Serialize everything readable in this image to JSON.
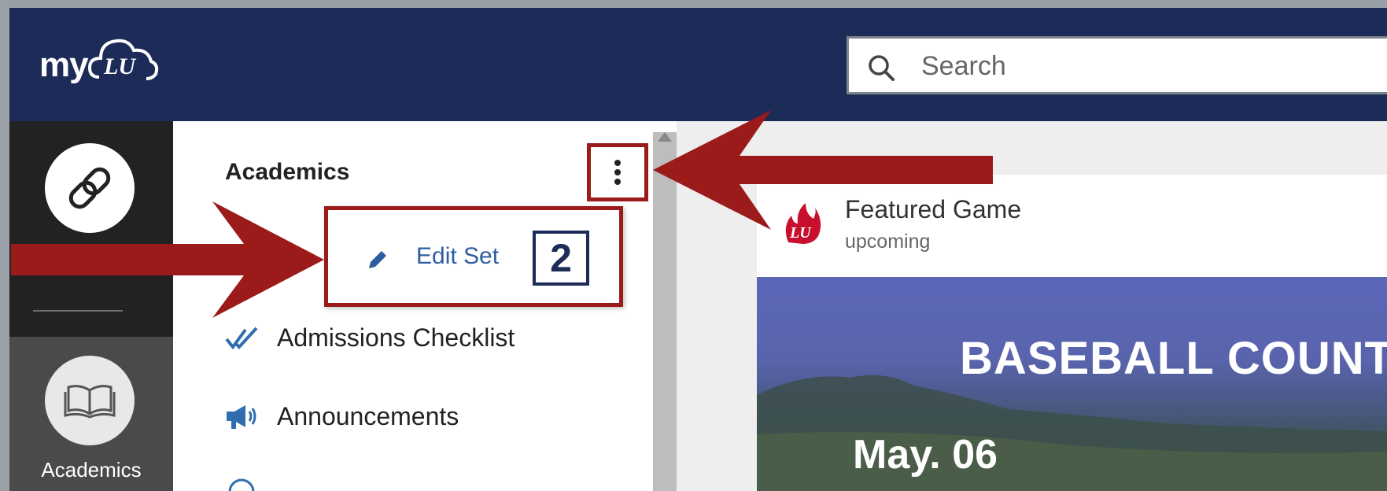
{
  "app": {
    "logo_text": "my"
  },
  "search": {
    "placeholder": "Search",
    "value": ""
  },
  "rail": {
    "active_label": "Academics"
  },
  "panel": {
    "title": "Academics",
    "menu": {
      "edit_label": "Edit Set"
    },
    "items": [
      {
        "label": "Admissions Checklist",
        "icon": "double-check-icon"
      },
      {
        "label": "Announcements",
        "icon": "megaphone-icon"
      }
    ]
  },
  "card": {
    "title": "Featured Game",
    "subtitle": "upcoming",
    "banner_title": "BASEBALL COUNTD",
    "banner_date": "May. 06"
  },
  "annotations": {
    "step_number": "2",
    "arrow_color": "#9b1a1a",
    "badge_color": "#1c2b57"
  },
  "colors": {
    "topbar": "#1c2b57",
    "rail_dark": "#222222",
    "link_blue": "#2f5e9e"
  }
}
